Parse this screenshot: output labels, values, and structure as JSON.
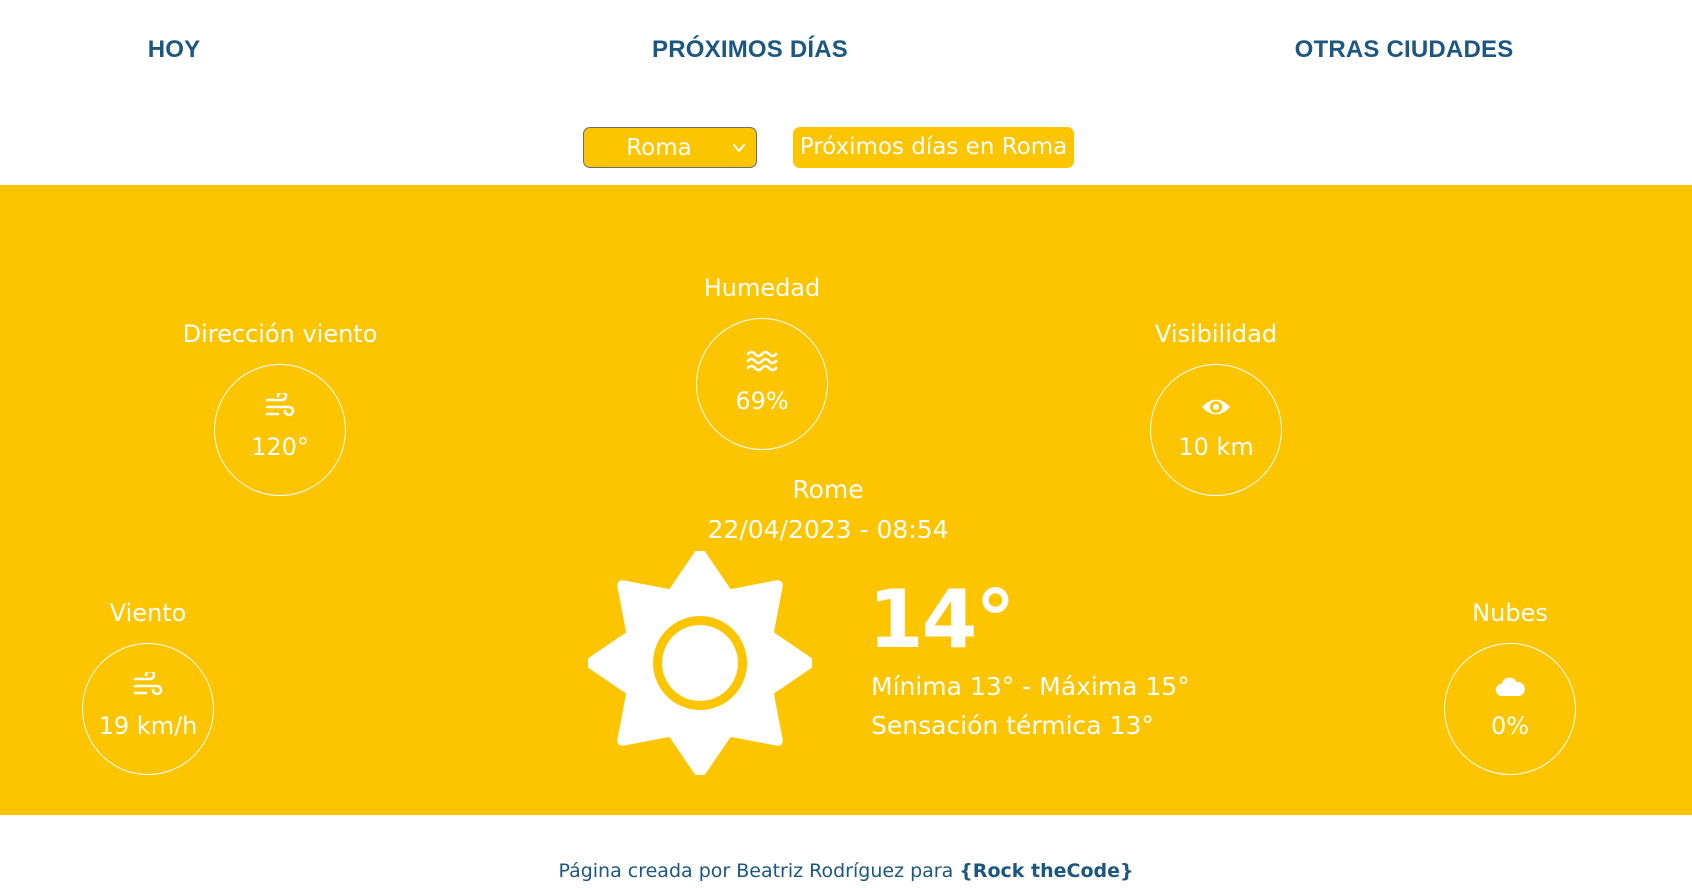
{
  "nav": {
    "hoy": "HOY",
    "proximos": "PRÓXIMOS DÍAS",
    "otras": "OTRAS CIUDADES"
  },
  "controls": {
    "city_selected": "Roma",
    "next_days_button": "Próximos días en Roma"
  },
  "stats": {
    "direccion": {
      "label": "Dirección viento",
      "value": "120°",
      "icon": "wind-icon"
    },
    "humedad": {
      "label": "Humedad",
      "value": "69%",
      "icon": "water-waves-icon"
    },
    "visibilidad": {
      "label": "Visibilidad",
      "value": "10 km",
      "icon": "eye-icon"
    },
    "viento": {
      "label": "Viento",
      "value": "19 km/h",
      "icon": "wind-icon"
    },
    "nubes": {
      "label": "Nubes",
      "value": "0%",
      "icon": "cloud-icon"
    }
  },
  "current": {
    "city": "Rome",
    "datetime": "22/04/2023 - 08:54",
    "temp": "14°",
    "minmax": "Mínima 13° - Máxima 15°",
    "feels": "Sensación térmica 13°",
    "icon": "sun-icon"
  },
  "footer": {
    "text": "Página creada por Beatriz Rodríguez para ",
    "brand": "{Rock theCode}"
  },
  "colors": {
    "accent": "#fcc500",
    "nav_text": "#1b5780",
    "panel_text": "#ffffff"
  }
}
